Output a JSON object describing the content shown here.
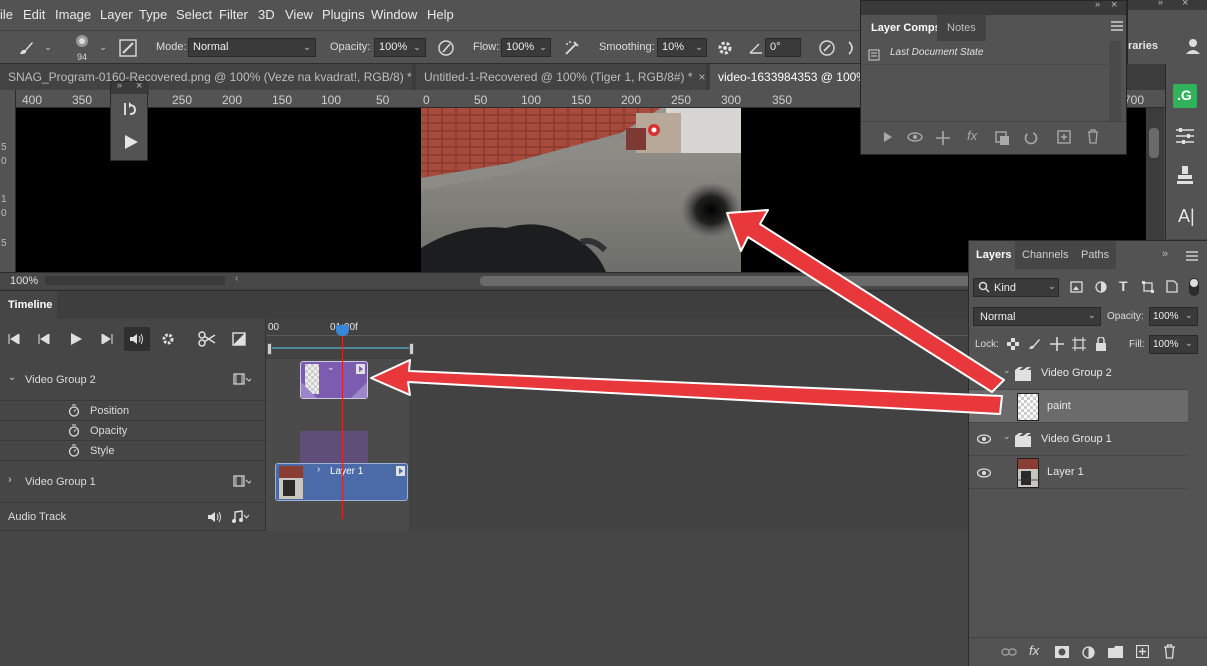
{
  "menu": [
    "ile",
    "Edit",
    "Image",
    "Layer",
    "Type",
    "Select",
    "Filter",
    "3D",
    "View",
    "Plugins",
    "Window",
    "Help"
  ],
  "options": {
    "brush_size": "94",
    "mode_label": "Mode:",
    "mode_value": "Normal",
    "opacity_label": "Opacity:",
    "opacity_value": "100%",
    "flow_label": "Flow:",
    "flow_value": "100%",
    "smoothing_label": "Smoothing:",
    "smoothing_value": "10%",
    "angle_value": "0°",
    "libraries_label": "raries"
  },
  "tabs": [
    {
      "label": "SNAG_Program-0160-Recovered.png @ 100% (Veze na kvadrat!, RGB/8) *"
    },
    {
      "label": "Untitled-1-Recovered @ 100% (Tiger 1, RGB/8#) *"
    },
    {
      "label": "video-1633984353 @ 100%"
    }
  ],
  "ruler": [
    "400",
    "350",
    "250",
    "200",
    "150",
    "100",
    "50",
    "0",
    "50",
    "100",
    "150",
    "200",
    "250",
    "300",
    "350",
    "700"
  ],
  "status": {
    "zoom": "100%"
  },
  "layer_comps": {
    "tab_active": "Layer Comps",
    "tab_notes": "Notes",
    "item": "Last Document State"
  },
  "timeline": {
    "title": "Timeline",
    "time_start": "00",
    "playhead": "01:00f",
    "tracks": {
      "group2": "Video Group 2",
      "position": "Position",
      "opacity": "Opacity",
      "style": "Style",
      "group1": "Video Group 1",
      "audio": "Audio Track"
    },
    "clip_layer1": "Layer 1"
  },
  "layers": {
    "tab_layers": "Layers",
    "tab_channels": "Channels",
    "tab_paths": "Paths",
    "filter_kind": "Kind",
    "blend_mode": "Normal",
    "opacity_label": "Opacity:",
    "opacity_value": "100%",
    "lock_label": "Lock:",
    "fill_label": "Fill:",
    "fill_value": "100%",
    "items": [
      {
        "name": "Video Group 2"
      },
      {
        "name": "paint"
      },
      {
        "name": "Video Group 1"
      },
      {
        "name": "Layer 1"
      }
    ]
  },
  "colors": {
    "annotation_arrow": "#e8383b",
    "clip_purple": "#7b5cb0",
    "clip_blue": "#4a6aa8",
    "playhead": "#d12a2a",
    "accent_green": "#2fb25a"
  }
}
